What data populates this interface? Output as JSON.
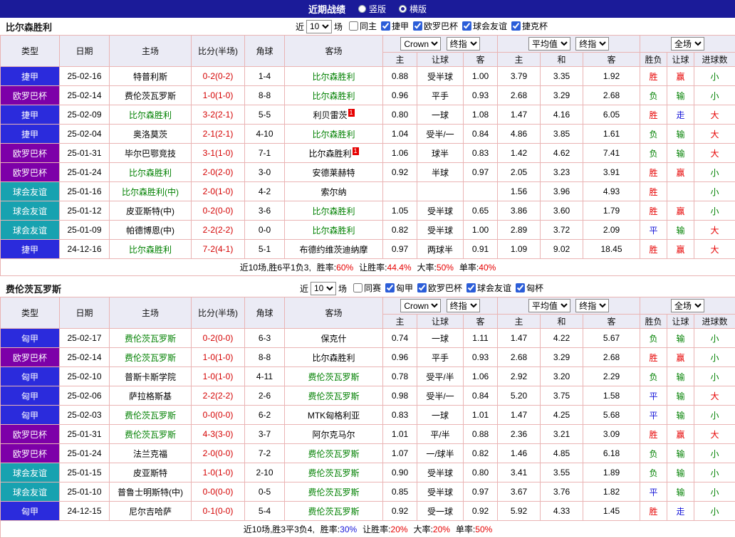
{
  "title_bar": {
    "title": "近期战绩",
    "layout_options": [
      {
        "label": "竖版",
        "selected": false
      },
      {
        "label": "横版",
        "selected": true
      }
    ]
  },
  "labels": {
    "near": "近",
    "matches": "场",
    "col_type": "类型",
    "col_date": "日期",
    "col_home": "主场",
    "col_score": "比分(半场)",
    "col_corner": "角球",
    "col_away": "客场",
    "bookmaker": "Crown",
    "final": "终指",
    "average": "平均值",
    "fulltime": "全场",
    "sub_home": "主",
    "sub_handicap": "让球",
    "sub_away": "客",
    "sub_draw": "和",
    "sub_result": "胜负",
    "sub_goals": "进球数"
  },
  "colors": {
    "league_blue": "#2b2bdc",
    "league_purple": "#7d00a8",
    "league_teal": "#17a2b0",
    "team_green": "#008000",
    "score_red": "#d40000",
    "win_red": "#e60000",
    "lose_green": "#008000",
    "draw_blue": "#1515d8"
  },
  "sections": [
    {
      "team": "比尔森胜利",
      "match_count": "10",
      "checkboxes": [
        {
          "label": "同主",
          "checked": false
        },
        {
          "label": "捷甲",
          "checked": true
        },
        {
          "label": "欧罗巴杯",
          "checked": true
        },
        {
          "label": "球会友谊",
          "checked": true
        },
        {
          "label": "捷克杯",
          "checked": true
        }
      ],
      "rows": [
        {
          "league": "捷甲",
          "lc": "league_blue",
          "date": "25-02-16",
          "home": "特普利斯",
          "hg": false,
          "hbadge": "",
          "score": "0-2(0-2)",
          "corner": "1-4",
          "away": "比尔森胜利",
          "ag": true,
          "abadge": "",
          "o1": "0.88",
          "hc": "受半球",
          "o2": "1.00",
          "m1": "3.79",
          "m2": "3.35",
          "m3": "1.92",
          "r1": "胜",
          "r2": "赢",
          "r3": "小"
        },
        {
          "league": "欧罗巴杯",
          "lc": "league_purple",
          "date": "25-02-14",
          "home": "费伦茨瓦罗斯",
          "hg": false,
          "hbadge": "",
          "score": "1-0(1-0)",
          "corner": "8-8",
          "away": "比尔森胜利",
          "ag": true,
          "abadge": "",
          "o1": "0.96",
          "hc": "平手",
          "o2": "0.93",
          "m1": "2.68",
          "m2": "3.29",
          "m3": "2.68",
          "r1": "负",
          "r2": "输",
          "r3": "小"
        },
        {
          "league": "捷甲",
          "lc": "league_blue",
          "date": "25-02-09",
          "home": "比尔森胜利",
          "hg": true,
          "hbadge": "",
          "score": "3-2(2-1)",
          "corner": "5-5",
          "away": "利贝雷茨",
          "ag": false,
          "abadge": "1",
          "o1": "0.80",
          "hc": "一球",
          "o2": "1.08",
          "m1": "1.47",
          "m2": "4.16",
          "m3": "6.05",
          "r1": "胜",
          "r2": "走",
          "r3": "大"
        },
        {
          "league": "捷甲",
          "lc": "league_blue",
          "date": "25-02-04",
          "home": "奥洛莫茨",
          "hg": false,
          "hbadge": "",
          "score": "2-1(2-1)",
          "corner": "4-10",
          "away": "比尔森胜利",
          "ag": true,
          "abadge": "",
          "o1": "1.04",
          "hc": "受半/一",
          "o2": "0.84",
          "m1": "4.86",
          "m2": "3.85",
          "m3": "1.61",
          "r1": "负",
          "r2": "输",
          "r3": "大"
        },
        {
          "league": "欧罗巴杯",
          "lc": "league_purple",
          "date": "25-01-31",
          "home": "毕尔巴鄂竞技",
          "hg": false,
          "hbadge": "",
          "score": "3-1(1-0)",
          "corner": "7-1",
          "away": "比尔森胜利",
          "ag": false,
          "abadge": "1",
          "o1": "1.06",
          "hc": "球半",
          "o2": "0.83",
          "m1": "1.42",
          "m2": "4.62",
          "m3": "7.41",
          "r1": "负",
          "r2": "输",
          "r3": "大"
        },
        {
          "league": "欧罗巴杯",
          "lc": "league_purple",
          "date": "25-01-24",
          "home": "比尔森胜利",
          "hg": true,
          "hbadge": "",
          "score": "2-0(2-0)",
          "corner": "3-0",
          "away": "安德莱赫特",
          "ag": false,
          "abadge": "",
          "o1": "0.92",
          "hc": "半球",
          "o2": "0.97",
          "m1": "2.05",
          "m2": "3.23",
          "m3": "3.91",
          "r1": "胜",
          "r2": "赢",
          "r3": "小"
        },
        {
          "league": "球会友谊",
          "lc": "league_teal",
          "date": "25-01-16",
          "home": "比尔森胜利(中)",
          "hg": true,
          "hbadge": "",
          "score": "2-0(1-0)",
          "corner": "4-2",
          "away": "索尔纳",
          "ag": false,
          "abadge": "",
          "o1": "",
          "hc": "",
          "o2": "",
          "m1": "1.56",
          "m2": "3.96",
          "m3": "4.93",
          "r1": "胜",
          "r2": "",
          "r3": "小"
        },
        {
          "league": "球会友谊",
          "lc": "league_teal",
          "date": "25-01-12",
          "home": "皮亚斯特(中)",
          "hg": false,
          "hbadge": "",
          "score": "0-2(0-0)",
          "corner": "3-6",
          "away": "比尔森胜利",
          "ag": true,
          "abadge": "",
          "o1": "1.05",
          "hc": "受半球",
          "o2": "0.65",
          "m1": "3.86",
          "m2": "3.60",
          "m3": "1.79",
          "r1": "胜",
          "r2": "赢",
          "r3": "小"
        },
        {
          "league": "球会友谊",
          "lc": "league_teal",
          "date": "25-01-09",
          "home": "帕德博恩(中)",
          "hg": false,
          "hbadge": "",
          "score": "2-2(2-2)",
          "corner": "0-0",
          "away": "比尔森胜利",
          "ag": true,
          "abadge": "",
          "o1": "0.82",
          "hc": "受半球",
          "o2": "1.00",
          "m1": "2.89",
          "m2": "3.72",
          "m3": "2.09",
          "r1": "平",
          "r2": "输",
          "r3": "大"
        },
        {
          "league": "捷甲",
          "lc": "league_blue",
          "date": "24-12-16",
          "home": "比尔森胜利",
          "hg": true,
          "hbadge": "",
          "score": "7-2(4-1)",
          "corner": "5-1",
          "away": "布德约维茨迪纳摩",
          "ag": false,
          "abadge": "",
          "o1": "0.97",
          "hc": "两球半",
          "o2": "0.91",
          "m1": "1.09",
          "m2": "9.02",
          "m3": "18.45",
          "r1": "胜",
          "r2": "赢",
          "r3": "大"
        }
      ],
      "summary": {
        "prefix": "近10场,胜6平1负3,",
        "stats": [
          {
            "label": "胜率:",
            "value": "60%",
            "color": "#e60000"
          },
          {
            "label": "让胜率:",
            "value": "44.4%",
            "color": "#e60000"
          },
          {
            "label": "大率:",
            "value": "50%",
            "color": "#e60000"
          },
          {
            "label": "单率:",
            "value": "40%",
            "color": "#e60000"
          }
        ]
      }
    },
    {
      "team": "费伦茨瓦罗斯",
      "match_count": "10",
      "checkboxes": [
        {
          "label": "同赛",
          "checked": false
        },
        {
          "label": "匈甲",
          "checked": true
        },
        {
          "label": "欧罗巴杯",
          "checked": true
        },
        {
          "label": "球会友谊",
          "checked": true
        },
        {
          "label": "匈杯",
          "checked": true
        }
      ],
      "rows": [
        {
          "league": "匈甲",
          "lc": "league_blue",
          "date": "25-02-17",
          "home": "费伦茨瓦罗斯",
          "hg": true,
          "hbadge": "",
          "score": "0-2(0-0)",
          "corner": "6-3",
          "away": "保克什",
          "ag": false,
          "abadge": "",
          "o1": "0.74",
          "hc": "一球",
          "o2": "1.11",
          "m1": "1.47",
          "m2": "4.22",
          "m3": "5.67",
          "r1": "负",
          "r2": "输",
          "r3": "小"
        },
        {
          "league": "欧罗巴杯",
          "lc": "league_purple",
          "date": "25-02-14",
          "home": "费伦茨瓦罗斯",
          "hg": true,
          "hbadge": "",
          "score": "1-0(1-0)",
          "corner": "8-8",
          "away": "比尔森胜利",
          "ag": false,
          "abadge": "",
          "o1": "0.96",
          "hc": "平手",
          "o2": "0.93",
          "m1": "2.68",
          "m2": "3.29",
          "m3": "2.68",
          "r1": "胜",
          "r2": "赢",
          "r3": "小"
        },
        {
          "league": "匈甲",
          "lc": "league_blue",
          "date": "25-02-10",
          "home": "普斯卡斯学院",
          "hg": false,
          "hbadge": "",
          "score": "1-0(1-0)",
          "corner": "4-11",
          "away": "费伦茨瓦罗斯",
          "ag": true,
          "abadge": "",
          "o1": "0.78",
          "hc": "受平/半",
          "o2": "1.06",
          "m1": "2.92",
          "m2": "3.20",
          "m3": "2.29",
          "r1": "负",
          "r2": "输",
          "r3": "小"
        },
        {
          "league": "匈甲",
          "lc": "league_blue",
          "date": "25-02-06",
          "home": "萨拉格斯基",
          "hg": false,
          "hbadge": "",
          "score": "2-2(2-2)",
          "corner": "2-6",
          "away": "费伦茨瓦罗斯",
          "ag": true,
          "abadge": "",
          "o1": "0.98",
          "hc": "受半/一",
          "o2": "0.84",
          "m1": "5.20",
          "m2": "3.75",
          "m3": "1.58",
          "r1": "平",
          "r2": "输",
          "r3": "大"
        },
        {
          "league": "匈甲",
          "lc": "league_blue",
          "date": "25-02-03",
          "home": "费伦茨瓦罗斯",
          "hg": true,
          "hbadge": "",
          "score": "0-0(0-0)",
          "corner": "6-2",
          "away": "MTK匈格利亚",
          "ag": false,
          "abadge": "",
          "o1": "0.83",
          "hc": "一球",
          "o2": "1.01",
          "m1": "1.47",
          "m2": "4.25",
          "m3": "5.68",
          "r1": "平",
          "r2": "输",
          "r3": "小"
        },
        {
          "league": "欧罗巴杯",
          "lc": "league_purple",
          "date": "25-01-31",
          "home": "费伦茨瓦罗斯",
          "hg": true,
          "hbadge": "",
          "score": "4-3(3-0)",
          "corner": "3-7",
          "away": "阿尔克马尔",
          "ag": false,
          "abadge": "",
          "o1": "1.01",
          "hc": "平/半",
          "o2": "0.88",
          "m1": "2.36",
          "m2": "3.21",
          "m3": "3.09",
          "r1": "胜",
          "r2": "赢",
          "r3": "大"
        },
        {
          "league": "欧罗巴杯",
          "lc": "league_purple",
          "date": "25-01-24",
          "home": "法兰克福",
          "hg": false,
          "hbadge": "",
          "score": "2-0(0-0)",
          "corner": "7-2",
          "away": "费伦茨瓦罗斯",
          "ag": true,
          "abadge": "",
          "o1": "1.07",
          "hc": "一/球半",
          "o2": "0.82",
          "m1": "1.46",
          "m2": "4.85",
          "m3": "6.18",
          "r1": "负",
          "r2": "输",
          "r3": "小"
        },
        {
          "league": "球会友谊",
          "lc": "league_teal",
          "date": "25-01-15",
          "home": "皮亚斯特",
          "hg": false,
          "hbadge": "",
          "score": "1-0(1-0)",
          "corner": "2-10",
          "away": "费伦茨瓦罗斯",
          "ag": true,
          "abadge": "",
          "o1": "0.90",
          "hc": "受半球",
          "o2": "0.80",
          "m1": "3.41",
          "m2": "3.55",
          "m3": "1.89",
          "r1": "负",
          "r2": "输",
          "r3": "小"
        },
        {
          "league": "球会友谊",
          "lc": "league_teal",
          "date": "25-01-10",
          "home": "普鲁士明斯特(中)",
          "hg": false,
          "hbadge": "",
          "score": "0-0(0-0)",
          "corner": "0-5",
          "away": "费伦茨瓦罗斯",
          "ag": true,
          "abadge": "",
          "o1": "0.85",
          "hc": "受半球",
          "o2": "0.97",
          "m1": "3.67",
          "m2": "3.76",
          "m3": "1.82",
          "r1": "平",
          "r2": "输",
          "r3": "小"
        },
        {
          "league": "匈甲",
          "lc": "league_blue",
          "date": "24-12-15",
          "home": "尼尔吉哈萨",
          "hg": false,
          "hbadge": "",
          "score": "0-1(0-0)",
          "corner": "5-4",
          "away": "费伦茨瓦罗斯",
          "ag": true,
          "abadge": "",
          "o1": "0.92",
          "hc": "受一球",
          "o2": "0.92",
          "m1": "5.92",
          "m2": "4.33",
          "m3": "1.45",
          "r1": "胜",
          "r2": "走",
          "r3": "小"
        }
      ],
      "summary": {
        "prefix": "近10场,胜3平3负4,",
        "stats": [
          {
            "label": "胜率:",
            "value": "30%",
            "color": "#1515d8"
          },
          {
            "label": "让胜率:",
            "value": "20%",
            "color": "#e60000"
          },
          {
            "label": "大率:",
            "value": "20%",
            "color": "#e60000"
          },
          {
            "label": "单率:",
            "value": "50%",
            "color": "#e60000"
          }
        ]
      }
    }
  ]
}
